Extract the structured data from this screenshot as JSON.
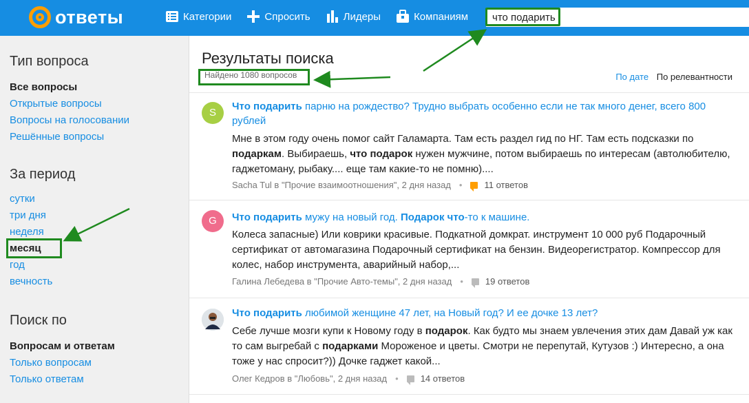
{
  "header": {
    "logo_text": "ответы",
    "nav": [
      {
        "label": "Категории",
        "icon": "list-icon"
      },
      {
        "label": "Спросить",
        "icon": "plus-icon"
      },
      {
        "label": "Лидеры",
        "icon": "bar-chart-icon"
      },
      {
        "label": "Компаниям",
        "icon": "briefcase-icon"
      }
    ],
    "search_value": "что подарить"
  },
  "sidebar": {
    "sections": [
      {
        "title": "Тип вопроса",
        "items": [
          {
            "label": "Все вопросы",
            "active": true
          },
          {
            "label": "Открытые вопросы",
            "active": false
          },
          {
            "label": "Вопросы на голосовании",
            "active": false
          },
          {
            "label": "Решённые вопросы",
            "active": false
          }
        ]
      },
      {
        "title": "За период",
        "items": [
          {
            "label": "сутки",
            "active": false
          },
          {
            "label": "три дня",
            "active": false
          },
          {
            "label": "неделя",
            "active": false
          },
          {
            "label": "месяц",
            "active": true
          },
          {
            "label": "год",
            "active": false
          },
          {
            "label": "вечность",
            "active": false
          }
        ]
      },
      {
        "title": "Поиск по",
        "items": [
          {
            "label": "Вопросам и ответам",
            "active": true
          },
          {
            "label": "Только вопросам",
            "active": false
          },
          {
            "label": "Только ответам",
            "active": false
          }
        ]
      }
    ]
  },
  "main": {
    "title": "Результаты поиска",
    "found": "Найдено 1080 вопросов",
    "sort": {
      "by_date": "По дате",
      "by_relevance": "По релевантности"
    },
    "results": [
      {
        "avatar_letter": "S",
        "avatar_color": "#a7cf44",
        "title_parts": [
          [
            "Что подарить",
            true
          ],
          [
            " парню на рождество? Трудно выбрать особенно если не так много денег, всего 800 рублей",
            false
          ]
        ],
        "text_parts": [
          [
            "Мне в этом году очень помог сайт Галамарта. Там есть раздел гид по НГ. Там есть подсказки по ",
            false
          ],
          [
            "подаркам",
            true
          ],
          [
            ". Выбираешь, ",
            false
          ],
          [
            "что подарок",
            true
          ],
          [
            " нужен мужчине, потом выбираешь по интересам (автолюбителю, гаджетоману, рыбаку.... еще там какие-то не помню)....",
            false
          ]
        ],
        "author": "Sacha Tul в \"Прочие взаимоотношения\", 2 дня назад",
        "answers": "11 ответов",
        "bubble": "orange"
      },
      {
        "avatar_letter": "G",
        "avatar_color": "#f06c8c",
        "title_parts": [
          [
            "Что подарить",
            true
          ],
          [
            " мужу на новый год. ",
            false
          ],
          [
            "Подарок что",
            true
          ],
          [
            "-то к машине.",
            false
          ]
        ],
        "text_parts": [
          [
            "Колеса запасные) Или коврики красивые. Подкатной домкрат. инструмент 10 000 руб Подарочный сертификат от автомагазина Подарочный сертификат на бензин. Видеорегистратор. Компрессор для колес, набор инструмента, аварийный набор,...",
            false
          ]
        ],
        "author": "Галина Лебедева в \"Прочие Авто-темы\", 2 дня назад",
        "answers": "19 ответов",
        "bubble": "gray"
      },
      {
        "avatar_letter": "",
        "avatar_color": "#cfd6dc",
        "title_parts": [
          [
            "Что подарить",
            true
          ],
          [
            " любимой женщине 47 лет, на Новый год? И ее дочке 13 лет?",
            false
          ]
        ],
        "text_parts": [
          [
            "Себе лучше мозги купи к Новому году в ",
            false
          ],
          [
            "подарок",
            true
          ],
          [
            ". Как будто мы знаем увлечения этих дам Давай уж как то сам выгребай с ",
            false
          ],
          [
            "подарками",
            true
          ],
          [
            " Мороженое и цветы. Смотри не перепутай, Кутузов :) Интересно, а она тоже у нас спросит?)) Дочке гаджет какой...",
            false
          ]
        ],
        "author": "Олег Кедров в \"Любовь\", 2 дня назад",
        "answers": "14 ответов",
        "bubble": "gray"
      }
    ]
  },
  "colors": {
    "brand": "#168de2",
    "accent": "#ff9e00",
    "annotation": "#1f8a1f"
  }
}
